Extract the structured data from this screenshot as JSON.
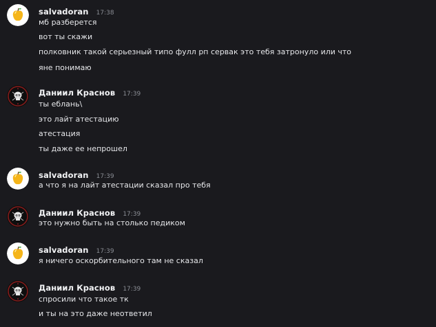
{
  "groups": [
    {
      "username": "salvadoran",
      "time": "17:38",
      "avatar_icon": "golden-apple-icon",
      "messages": [
        "мб разберется",
        "вот ты скажи",
        "полковник такой серьезный типо фулл рп сервак это тебя затронуло или что",
        "яне понимаю"
      ]
    },
    {
      "username": "Даниил Краснов",
      "time": "17:39",
      "avatar_icon": "skull-emblem-icon",
      "messages": [
        "ты еблань\\",
        "это лайт атестацию",
        "атестация",
        "ты даже ее непрошел"
      ]
    },
    {
      "username": "salvadoran",
      "time": "17:39",
      "avatar_icon": "golden-apple-icon",
      "messages": [
        "а что я на лайт атестации сказал про тебя"
      ]
    },
    {
      "username": "Даниил Краснов",
      "time": "17:39",
      "avatar_icon": "skull-emblem-icon",
      "messages": [
        "это нужно быть на столько педиком"
      ]
    },
    {
      "username": "salvadoran",
      "time": "17:39",
      "avatar_icon": "golden-apple-icon",
      "messages": [
        "я ничего оскорбительного там не сказал"
      ]
    },
    {
      "username": "Даниил Краснов",
      "time": "17:39",
      "avatar_icon": "skull-emblem-icon",
      "messages": [
        "спросили что такое тк",
        "и ты на это даже неответил"
      ]
    }
  ]
}
